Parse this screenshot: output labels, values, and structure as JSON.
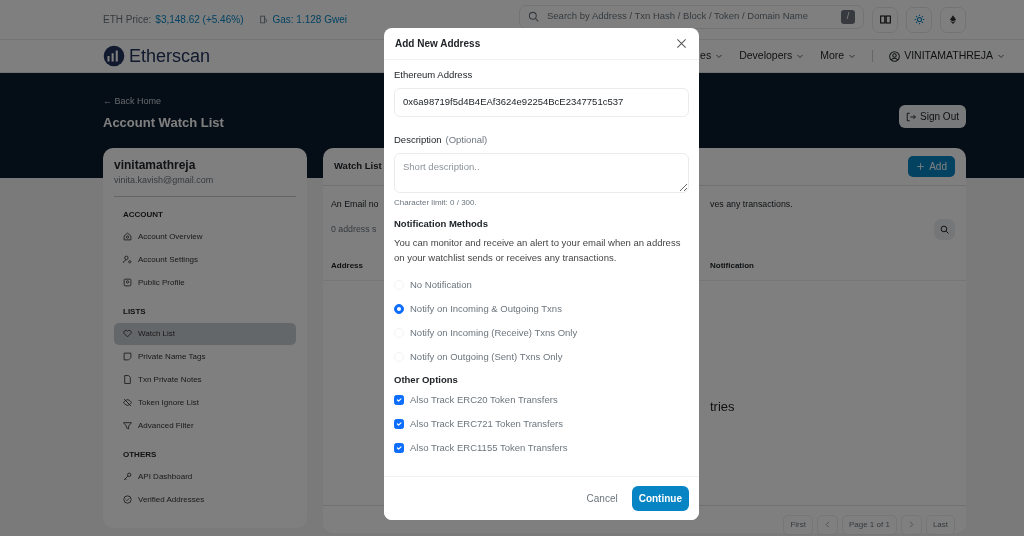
{
  "topbar": {
    "eth_price_label": "ETH Price:",
    "eth_price_value": "$3,148.62 (+5.46%)",
    "gas": "Gas: 1.128 Gwei"
  },
  "search": {
    "placeholder": "Search by Address / Txn Hash / Block / Token / Domain Name",
    "shortcut": "/"
  },
  "brand": "Etherscan",
  "nav": [
    {
      "label": "es"
    },
    {
      "label": "Developers"
    },
    {
      "label": "More"
    }
  ],
  "user": "VINITAMATHREJA",
  "hero": {
    "back": "← Back Home",
    "title": "Account Watch List",
    "sign_out": "Sign Out"
  },
  "sidebar": {
    "name": "vinitamathreja",
    "email": "vinita.kavish@gmail.com",
    "sections": [
      {
        "heading": "ACCOUNT",
        "items": [
          {
            "label": "Account Overview",
            "selected": false
          },
          {
            "label": "Account Settings",
            "selected": false
          },
          {
            "label": "Public Profile",
            "selected": false
          }
        ]
      },
      {
        "heading": "LISTS",
        "items": [
          {
            "label": "Watch List",
            "selected": true
          },
          {
            "label": "Private Name Tags",
            "selected": false
          },
          {
            "label": "Txn Private Notes",
            "selected": false
          },
          {
            "label": "Token Ignore List",
            "selected": false
          },
          {
            "label": "Advanced Filter",
            "selected": false
          }
        ]
      },
      {
        "heading": "OTHERS",
        "items": [
          {
            "label": "API Dashboard",
            "selected": false
          },
          {
            "label": "Verified Addresses",
            "selected": false
          }
        ]
      }
    ]
  },
  "watchlist": {
    "title": "Watch List",
    "add_button": "Add",
    "note_start": "An Email no",
    "note_end": "ves any transactions.",
    "count_start": "0 address s",
    "columns": [
      "Address",
      "Notification"
    ],
    "empty_fragment": "tries",
    "pagination": {
      "first": "First",
      "page": "Page 1 of 1",
      "last": "Last"
    }
  },
  "modal": {
    "title": "Add New Address",
    "address_label": "Ethereum Address",
    "address_value": "0x6a98719f5d4B4EAf3624e92254BcE2347751c537",
    "description_label": "Description",
    "description_hint": "(Optional)",
    "description_placeholder": "Short description..",
    "char_limit": "Character limit: 0 / 300.",
    "methods_heading": "Notification Methods",
    "methods_text": "You can monitor and receive an alert to your email when an address on your watchlist sends or receives any transactions.",
    "notification_options": [
      {
        "label": "No Notification",
        "selected": false
      },
      {
        "label": "Notify on Incoming & Outgoing Txns",
        "selected": true
      },
      {
        "label": "Notify on Incoming (Receive) Txns Only",
        "selected": false
      },
      {
        "label": "Notify on Outgoing (Sent) Txns Only",
        "selected": false
      }
    ],
    "other_heading": "Other Options",
    "other_options": [
      {
        "label": "Also Track ERC20 Token Transfers",
        "checked": true
      },
      {
        "label": "Also Track ERC721 Token Transfers",
        "checked": true
      },
      {
        "label": "Also Track ERC1155 Token Transfers",
        "checked": true
      }
    ],
    "cancel": "Cancel",
    "continue": "Continue"
  }
}
